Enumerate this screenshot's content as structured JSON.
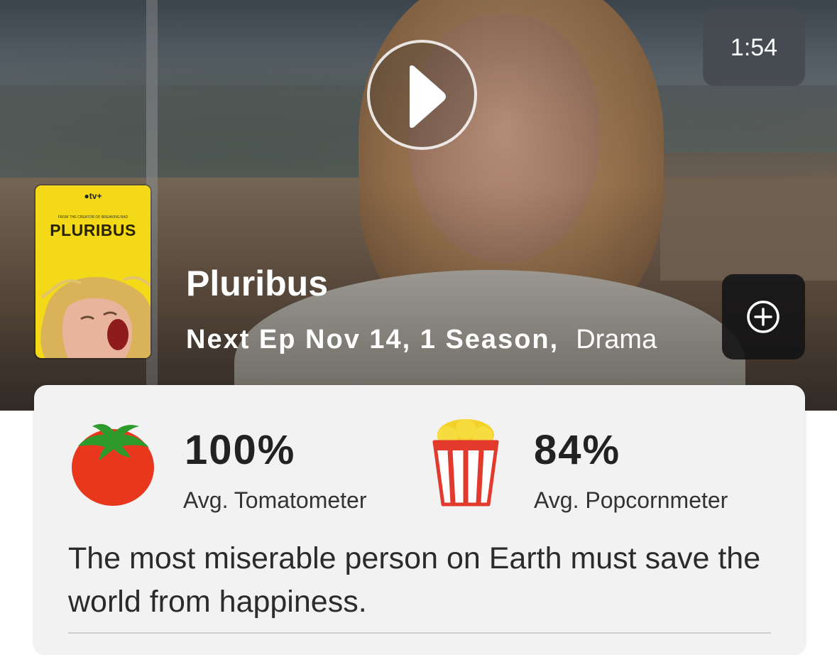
{
  "hero": {
    "duration": "1:54",
    "play_icon": "play-icon",
    "add_icon": "plus-circle-icon"
  },
  "poster": {
    "brand": "tv+",
    "credit": "FROM THE CREATOR OF BREAKING BAD",
    "title": "PLURIBUS"
  },
  "show": {
    "title": "Pluribus",
    "meta": "Next Ep Nov 14, 1 Season,",
    "genre": "Drama"
  },
  "ratings": {
    "tomatometer": {
      "value": "100%",
      "label": "Avg. Tomatometer",
      "icon": "tomato-icon"
    },
    "popcornmeter": {
      "value": "84%",
      "label": "Avg. Popcornmeter",
      "icon": "popcorn-icon"
    }
  },
  "synopsis": "The most miserable person on Earth must save the world from happiness.",
  "colors": {
    "poster_yellow": "#f3d917",
    "tomato_red": "#e8371d",
    "tomato_leaf": "#2f9a2c",
    "popcorn_red": "#e23b2e",
    "card_bg": "#f2f2f2"
  }
}
